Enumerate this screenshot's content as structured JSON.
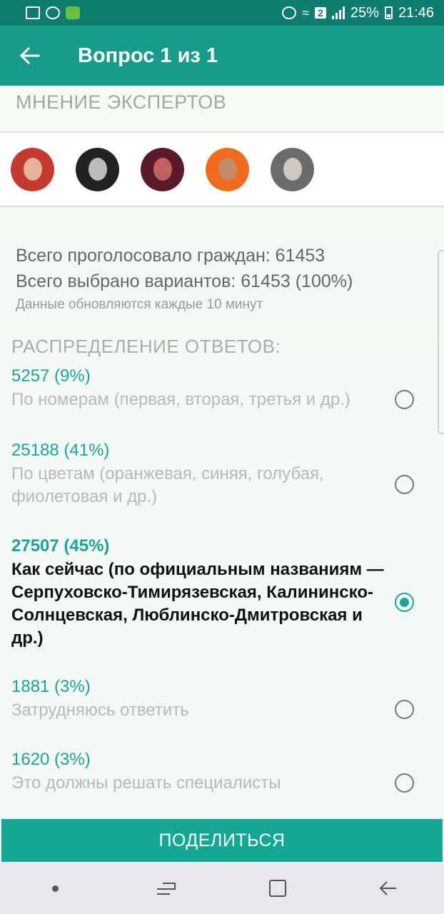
{
  "status_bar": {
    "battery": "25%",
    "time": "21:46",
    "sim_badge": "2",
    "icons": [
      "image-icon",
      "at-icon",
      "app-icon",
      "alarm-icon",
      "wifi-icon",
      "signal-icon",
      "battery-icon"
    ]
  },
  "app_bar": {
    "title": "Вопрос 1 из 1",
    "back_icon": "arrow-left-icon"
  },
  "experts": {
    "header": "МНЕНИЕ ЭКСПЕРТОВ",
    "avatars": [
      {
        "bg": "#c43a2e",
        "face": "#e6b39a"
      },
      {
        "bg": "#222222",
        "face": "#bbbbbb"
      },
      {
        "bg": "#5a1a2a",
        "face": "#c06060"
      },
      {
        "bg": "#f06b1e",
        "face": "#c28a6a"
      },
      {
        "bg": "#6b6b6b",
        "face": "#d0c8c0"
      }
    ]
  },
  "stats": {
    "total_citizens": "Всего проголосовало граждан: 61453",
    "total_options": "Всего выбрано вариантов: 61453 (100%)",
    "update_note": "Данные обновляются каждые 10 минут"
  },
  "distribution": {
    "title": "РАСПРЕДЕЛЕНИЕ ОТВЕТОВ:",
    "options": [
      {
        "count": "5257 (9%)",
        "label": "По номерам (первая, вторая, третья и др.)",
        "selected": false
      },
      {
        "count": "25188 (41%)",
        "label": "По цветам (оранжевая, синяя, голубая, фиолетовая и др.)",
        "selected": false
      },
      {
        "count": "27507 (45%)",
        "label": "Как сейчас (по официальным названиям — Серпуховско-Тимирязевская, Калининско-Солнцевская, Люблинско-Дмитровская и др.)",
        "selected": true
      },
      {
        "count": "1881 (3%)",
        "label": "Затрудняюсь ответить",
        "selected": false
      },
      {
        "count": "1620 (3%)",
        "label": "Это должны решать специалисты",
        "selected": false
      }
    ]
  },
  "share_button": "ПОДЕЛИТЬСЯ",
  "colors": {
    "primary": "#169c88",
    "status_bar": "#0f7d6e",
    "accent_text": "#1aa594"
  }
}
